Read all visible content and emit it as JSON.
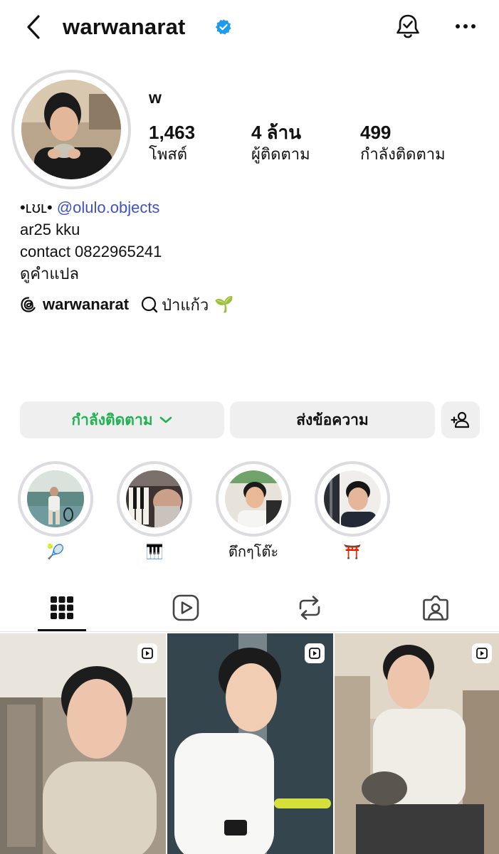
{
  "header": {
    "username": "warwanarat",
    "verified_icon": "verified-badge-icon",
    "back_icon": "chevron-left-icon",
    "bell_icon": "bell-check-icon",
    "more_icon": "more-horizontal-icon"
  },
  "profile": {
    "display_name": "w",
    "stats": [
      {
        "value": "1,463",
        "label": "โพสต์"
      },
      {
        "value": "4 ล้าน",
        "label": "ผู้ติดตาม"
      },
      {
        "value": "499",
        "label": "กำลังติดตาม"
      }
    ],
    "bio": {
      "prefix": "•ʟʊʟ• ",
      "mention": "@olulo.objects",
      "line2": "ar25 kku",
      "line3": "contact 0822965241",
      "translate": "ดูคำแปล"
    },
    "threads": {
      "handle": "warwanarat",
      "note": "ป่าแก้ว",
      "emoji": "🌱"
    }
  },
  "actions": {
    "following": "กำลังติดตาม",
    "message": "ส่งข้อความ",
    "add_user_icon": "add-person-icon"
  },
  "highlights": [
    {
      "label": "🎾"
    },
    {
      "label": "🎹"
    },
    {
      "label": "ตึกๆโต๊ะ"
    },
    {
      "label": "⛩️"
    }
  ],
  "tabs": [
    "grid-icon",
    "reels-icon",
    "reposts-icon",
    "tagged-icon"
  ],
  "colors": {
    "accent_link": "#3f51c7",
    "following_green": "#1eb34f",
    "verified_blue": "#1d9bf0",
    "button_bg": "#efefef"
  }
}
